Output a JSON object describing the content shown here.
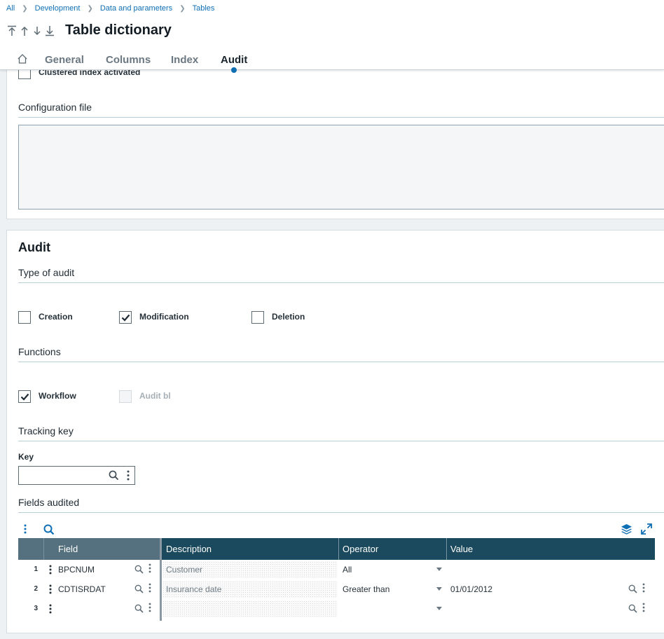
{
  "breadcrumb": [
    "All",
    "Development",
    "Data and parameters",
    "Tables"
  ],
  "title": "Table dictionary",
  "tabs": [
    "General",
    "Columns",
    "Index",
    "Audit"
  ],
  "active_tab": "Audit",
  "index_section": {
    "clustered_label": "Clustered index activated",
    "clustered_checked": false,
    "config_file_label": "Configuration file",
    "config_file_value": ""
  },
  "audit": {
    "title": "Audit",
    "type_label": "Type of audit",
    "types": [
      {
        "label": "Creation",
        "checked": false
      },
      {
        "label": "Modification",
        "checked": true
      },
      {
        "label": "Deletion",
        "checked": false
      }
    ],
    "functions_label": "Functions",
    "functions": [
      {
        "label": "Workflow",
        "checked": true,
        "disabled": false
      },
      {
        "label": "Audit bl",
        "checked": false,
        "disabled": true
      }
    ],
    "tracking_label": "Tracking key",
    "key_label": "Key",
    "key_value": "",
    "fields_label": "Fields audited"
  },
  "grid": {
    "columns": [
      "Field",
      "Description",
      "Operator",
      "Value"
    ],
    "rows": [
      {
        "num": "1",
        "field": "BPCNUM",
        "description": "Customer",
        "operator": "All",
        "value": ""
      },
      {
        "num": "2",
        "field": "CDTISRDAT",
        "description": "Insurance date",
        "operator": "Greater than",
        "value": "01/01/2012"
      },
      {
        "num": "3",
        "field": "",
        "description": "",
        "operator": "",
        "value": ""
      }
    ]
  },
  "colors": {
    "accent": "#0f6fb5",
    "grid_header": "#1b4a5e",
    "grid_header_frozen": "#55717f"
  }
}
